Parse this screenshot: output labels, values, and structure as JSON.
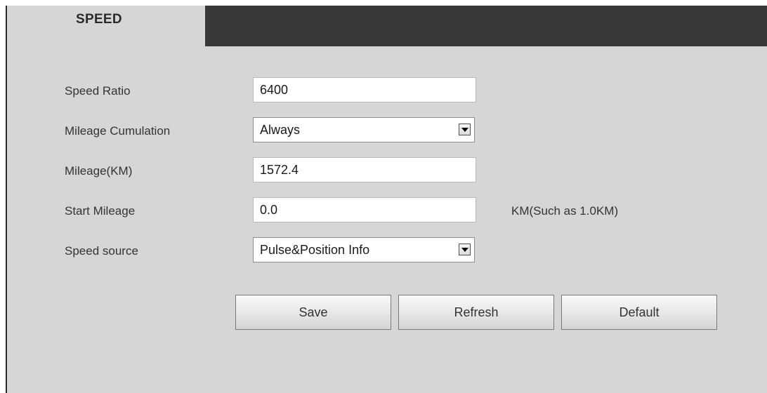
{
  "tab": {
    "label": "SPEED"
  },
  "form": {
    "speed_ratio": {
      "label": "Speed Ratio",
      "value": "6400"
    },
    "mileage_cumulation": {
      "label": "Mileage Cumulation",
      "value": "Always"
    },
    "mileage_km": {
      "label": "Mileage(KM)",
      "value": "1572.4"
    },
    "start_mileage": {
      "label": "Start Mileage",
      "value": "0.0",
      "hint": "KM(Such as 1.0KM)"
    },
    "speed_source": {
      "label": "Speed source",
      "value": "Pulse&Position Info"
    }
  },
  "buttons": {
    "save": "Save",
    "refresh": "Refresh",
    "default": "Default"
  },
  "icons": {
    "dropdown": "dropdown-arrow-icon"
  },
  "colors": {
    "panel_bg": "#d6d6d6",
    "tab_bar_bg": "#383838"
  }
}
